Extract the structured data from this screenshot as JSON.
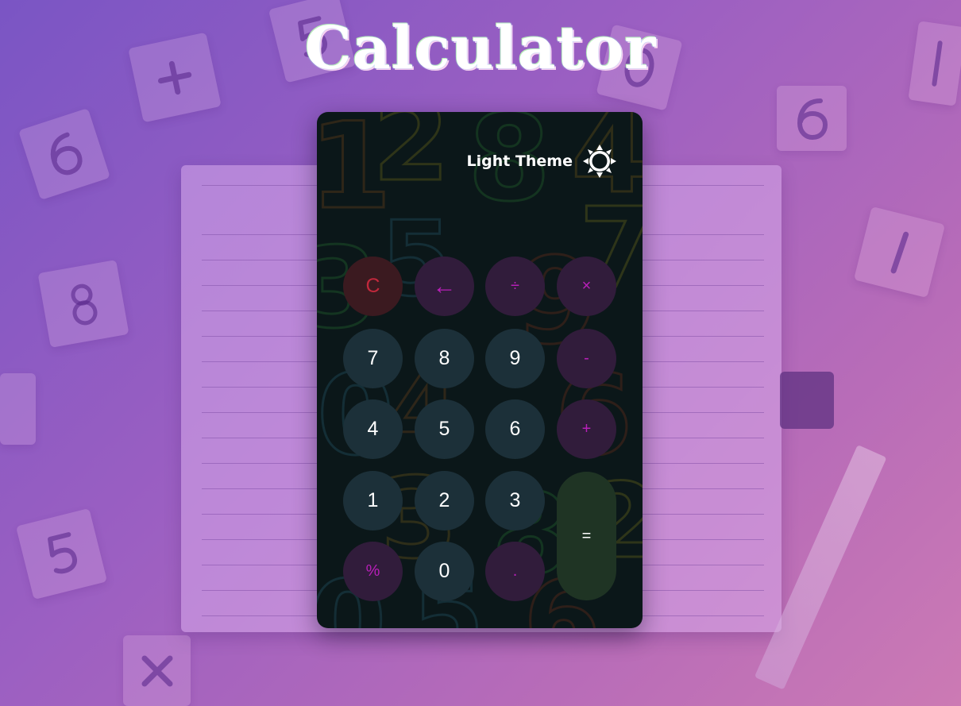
{
  "title": "Calculator",
  "theme_toggle": {
    "label": "Light Theme",
    "icon": "sun-icon"
  },
  "keypad": {
    "clear": "C",
    "backspace": "←",
    "divide": "÷",
    "multiply": "×",
    "seven": "7",
    "eight": "8",
    "nine": "9",
    "subtract": "-",
    "four": "4",
    "five": "5",
    "six": "6",
    "add": "+",
    "one": "1",
    "two": "2",
    "three": "3",
    "equals": "=",
    "percent": "%",
    "zero": "0",
    "decimal": "."
  },
  "colors": {
    "card": "#0b1719",
    "number_key": "#1c3039",
    "operator_key": "#311c3b",
    "operator_text": "#b81fb8",
    "clear_key": "#3b1a20",
    "clear_text": "#c2283c",
    "equals_key": "#1f3424"
  }
}
